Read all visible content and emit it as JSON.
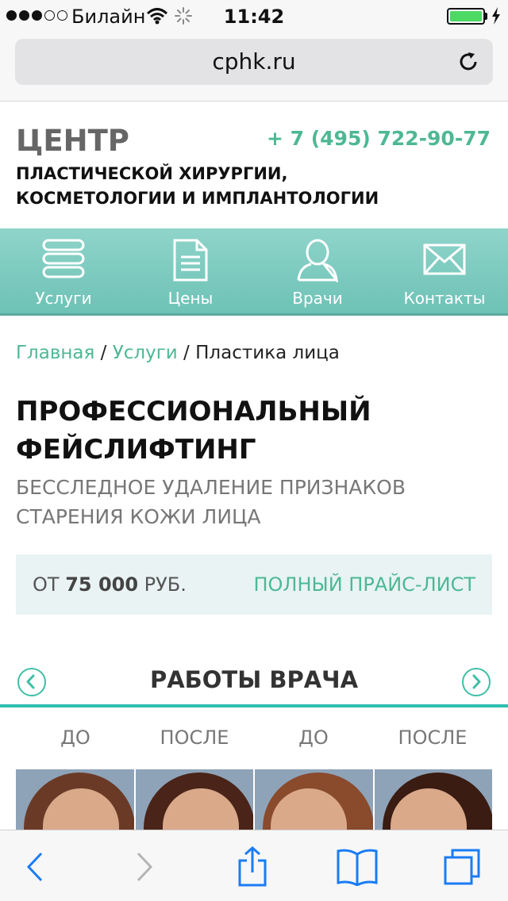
{
  "status_bar": {
    "carrier": "Билайн",
    "time": "11:42",
    "signal_bars_filled": 3,
    "signal_bars_total": 5,
    "battery_level": 1.0,
    "battery_color": "#4cd964"
  },
  "browser": {
    "url": "cphk.ru",
    "icons": [
      "reload-icon",
      "back-icon",
      "forward-icon",
      "share-icon",
      "bookmarks-icon",
      "tabs-icon"
    ]
  },
  "header": {
    "brand": "ЦЕНТР",
    "phone": "+ 7 (495) 722-90-77",
    "subtitle_line1": "ПЛАСТИЧЕСКОЙ ХИРУРГИИ,",
    "subtitle_line2": "КОСМЕТОЛОГИИ И ИМПЛАНТОЛОГИИ"
  },
  "nav": {
    "items": [
      {
        "label": "Услуги",
        "icon": "list-icon"
      },
      {
        "label": "Цены",
        "icon": "document-icon"
      },
      {
        "label": "Врачи",
        "icon": "person-icon"
      },
      {
        "label": "Контакты",
        "icon": "envelope-icon"
      }
    ]
  },
  "breadcrumb": {
    "home": "Главная",
    "sep1": " / ",
    "services": "Услуги",
    "sep2": " / ",
    "current": "Пластика лица"
  },
  "page": {
    "title_line1": "ПРОФЕССИОНАЛЬНЫЙ",
    "title_line2": "ФЕЙСЛИФТИНГ",
    "subtitle_line1": "БЕССЛЕДНОЕ УДАЛЕНИЕ ПРИЗНАКОВ",
    "subtitle_line2": "СТАРЕНИЯ КОЖИ ЛИЦА"
  },
  "price": {
    "prefix": "ОТ ",
    "amount": "75 000",
    "suffix": " РУБ.",
    "link": "ПОЛНЫЙ ПРАЙС-ЛИСТ"
  },
  "works": {
    "title": "РАБОТЫ ВРАЧА",
    "labels": [
      "ДО",
      "ПОСЛЕ",
      "ДО",
      "ПОСЛЕ"
    ]
  },
  "colors": {
    "accent": "#4db894",
    "nav_bg": "#7ccac0",
    "price_bg": "#e9f3f3",
    "ios_blue": "#1a7cf5"
  }
}
